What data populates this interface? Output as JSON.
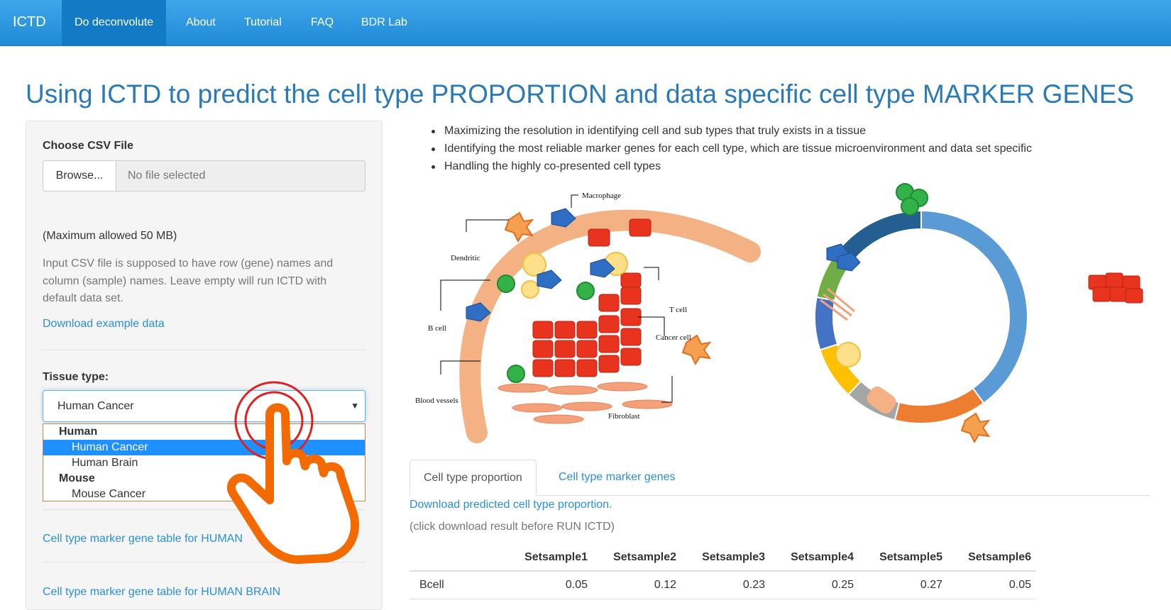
{
  "nav": {
    "brand": "ICTD",
    "items": [
      {
        "label": "Do deconvolute",
        "active": true
      },
      {
        "label": "About"
      },
      {
        "label": "Tutorial"
      },
      {
        "label": "FAQ"
      },
      {
        "label": "BDR Lab"
      }
    ]
  },
  "page_title": "Using ICTD to predict the cell type PROPORTION and data specific cell type MARKER GENES",
  "sidebar": {
    "file_label": "Choose CSV File",
    "browse_label": "Browse...",
    "file_placeholder": "No file selected",
    "max_size_note": "(Maximum allowed 50 MB)",
    "help_text": "Input CSV file is supposed to have row (gene) names and column (sample) names. Leave empty will run ICTD with default data set.",
    "download_example": "Download example data",
    "tissue_label": "Tissue type:",
    "tissue_selected": "Human Cancer",
    "tissue_options": {
      "group_human": "Human",
      "human_cancer": "Human Cancer",
      "human_brain": "Human Brain",
      "group_mouse": "Mouse",
      "mouse_cancer": "Mouse Cancer"
    },
    "marker_table_human": "Cell type marker gene table for HUMAN",
    "marker_table_brain": "Cell type marker gene table for HUMAN BRAIN"
  },
  "bullets": [
    "Maximizing the resolution in identifying cell and sub types that truly exists in a tissue",
    "Identifying the most reliable marker genes for each cell type, which are tissue microenvironment and data set specific",
    "Handling the highly co-presented cell types"
  ],
  "figure": {
    "labels": {
      "macrophage": "Macrophage",
      "dendritic": "Dendritic",
      "t_cell": "T cell",
      "b_cell": "B cell",
      "cancer_cell": "Cancer cell",
      "blood_vessels": "Blood vessels",
      "fibroblast": "Fibroblast"
    },
    "donut_colors": [
      "#5b9bd5",
      "#ed7d31",
      "#a5a5a5",
      "#ffc000",
      "#4472c4",
      "#70ad47",
      "#255e91"
    ],
    "donut_values": [
      0.4,
      0.14,
      0.08,
      0.08,
      0.08,
      0.08,
      0.14
    ]
  },
  "tabs": {
    "proportion": "Cell type proportion",
    "markers": "Cell type marker genes"
  },
  "results": {
    "download_link": "Download predicted cell type proportion.",
    "note": "(click download result before RUN ICTD)",
    "columns": [
      "",
      "Setsample1",
      "Setsample2",
      "Setsample3",
      "Setsample4",
      "Setsample5",
      "Setsample6"
    ],
    "rows": [
      {
        "name": "Bcell",
        "values": [
          "0.05",
          "0.12",
          "0.23",
          "0.25",
          "0.27",
          "0.05"
        ]
      }
    ]
  }
}
